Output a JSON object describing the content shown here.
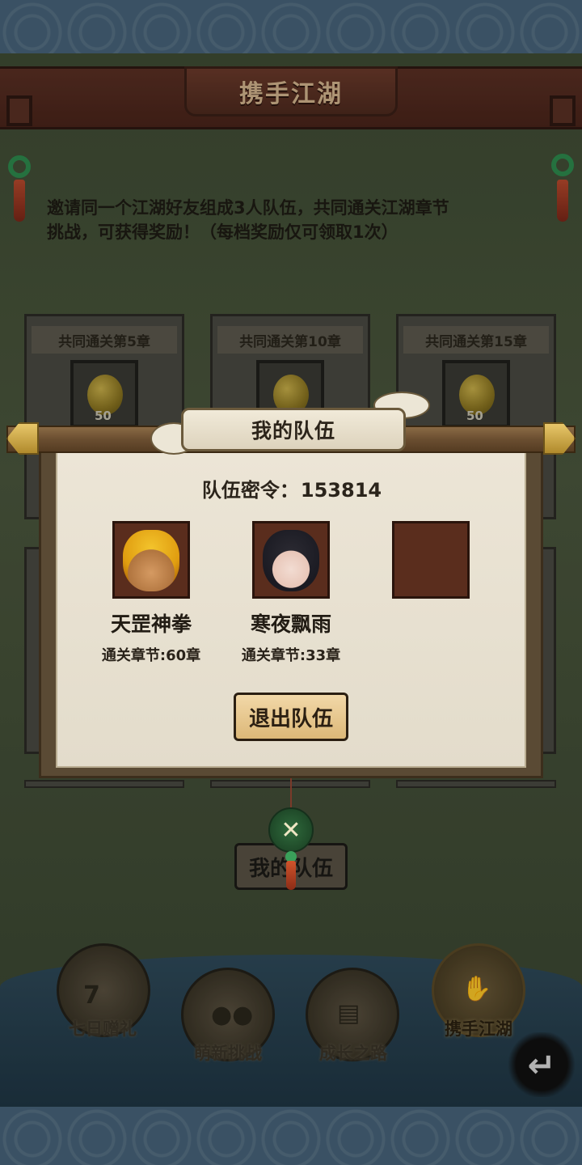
{
  "header": {
    "title": "携手江湖"
  },
  "intro": {
    "text_line1": "邀请同一个江湖好友组成3人队伍，共同通关江湖章节",
    "text_line2": "挑战，可获得奖励！（每档奖励仅可领取1次）"
  },
  "rewards": [
    {
      "title": "共同通关第5章",
      "quantity": "50",
      "icon": "golden-gourd-icon"
    },
    {
      "title": "共同通关第10章",
      "quantity": "",
      "icon": "golden-gourd-icon"
    },
    {
      "title": "共同通关第15章",
      "quantity": "50",
      "icon": "golden-gourd-icon"
    }
  ],
  "dialog": {
    "title": "我的队伍",
    "team_code_label": "队伍密令：",
    "team_code": "153814",
    "members": [
      {
        "name": "天罡神拳",
        "chapter": "通关章节:60章",
        "avatar": "golden-haired-warrior"
      },
      {
        "name": "寒夜飘雨",
        "chapter": "通关章节:33章",
        "avatar": "dark-haired-maiden"
      },
      {
        "name": "",
        "chapter": "",
        "avatar": "empty"
      }
    ],
    "exit_button": "退出队伍",
    "close_glyph": "✕"
  },
  "background_button": "我的队伍",
  "bottom_nav": [
    {
      "label": "七日赠礼",
      "icon": "gift-box-icon",
      "glyph": "7",
      "active": false
    },
    {
      "label": "萌新挑战",
      "icon": "panda-face-icon",
      "glyph": "",
      "active": false
    },
    {
      "label": "成长之路",
      "icon": "growth-book-icon",
      "glyph": "",
      "active": false
    },
    {
      "label": "携手江湖",
      "icon": "handshake-icon",
      "glyph": "",
      "active": true
    }
  ],
  "back_glyph": "↵",
  "colors": {
    "banner": "#5a3024",
    "title_text": "#d4b58e",
    "dialog_bg": "#ece5d6",
    "exit_button": "#dcb878",
    "close_disc": "#2f6a3c"
  }
}
